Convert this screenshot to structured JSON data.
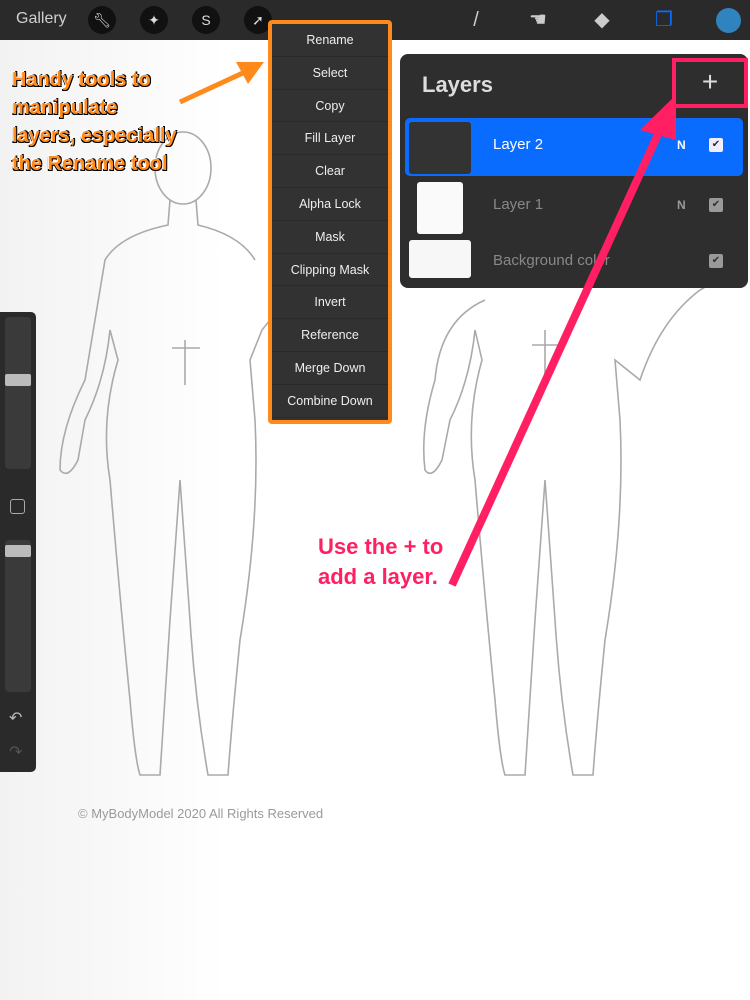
{
  "toolbar": {
    "gallery": "Gallery",
    "left_tools": [
      "wrench-icon",
      "magic-wand-icon",
      "selection-icon",
      "move-arrow-icon"
    ],
    "right_tools": [
      "brush-icon",
      "smudge-icon",
      "eraser-icon",
      "layers-icon"
    ],
    "color": "#2f84c0"
  },
  "menu": {
    "items": [
      "Rename",
      "Select",
      "Copy",
      "Fill Layer",
      "Clear",
      "Alpha Lock",
      "Mask",
      "Clipping Mask",
      "Invert",
      "Reference",
      "Merge Down",
      "Combine Down"
    ]
  },
  "layers": {
    "title": "Layers",
    "add": "+",
    "rows": [
      {
        "name": "Layer 2",
        "blend": "N",
        "visible": true,
        "selected": true
      },
      {
        "name": "Layer 1",
        "blend": "N",
        "visible": true,
        "selected": false
      },
      {
        "name": "Background color",
        "blend": "",
        "visible": true,
        "selected": false
      }
    ]
  },
  "copyright": "© MyBodyModel 2020 All Rights Reserved",
  "annotations": {
    "orange": "Handy tools to manipulate layers, especially the Rename tool",
    "pink": "Use the + to add a layer."
  },
  "colors": {
    "accent": "#0a6cff",
    "orange": "#ff8a1c",
    "pink": "#ff1f62"
  }
}
